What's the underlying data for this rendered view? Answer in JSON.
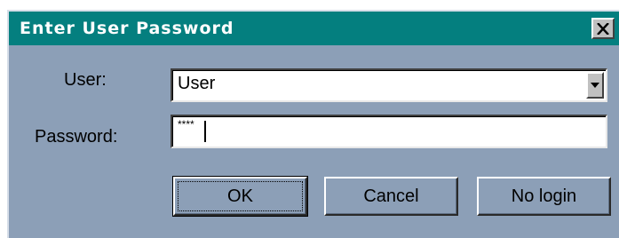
{
  "dialog": {
    "title": "Enter User Password",
    "close_glyph": "✕",
    "close_icon": "close-icon"
  },
  "form": {
    "user_label": "User:",
    "user_value": "User",
    "user_dropdown_icon": "chevron-down-icon",
    "password_label": "Password:",
    "password_mask": "****"
  },
  "buttons": {
    "ok_label": "OK",
    "cancel_label": "Cancel",
    "nologin_label": "No login"
  }
}
